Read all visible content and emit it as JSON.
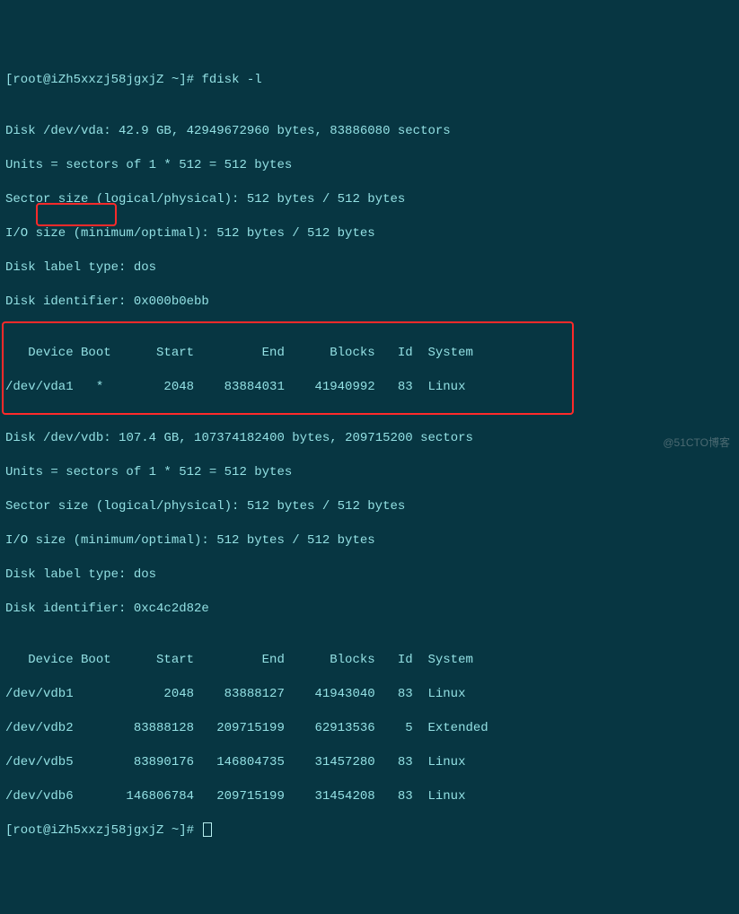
{
  "prompt1": {
    "open": "[",
    "user_host": "root@iZh5xxzj58jgxjZ",
    "cwd": " ~",
    "close": "]# ",
    "command": "fdisk -l"
  },
  "blank": "",
  "vda": {
    "header": "Disk /dev/vda: 42.9 GB, 42949672960 bytes, 83886080 sectors",
    "units": "Units = sectors of 1 * 512 = 512 bytes",
    "sector": "Sector size (logical/physical): 512 bytes / 512 bytes",
    "io": "I/O size (minimum/optimal): 512 bytes / 512 bytes",
    "label": "Disk label type: dos",
    "ident": "Disk identifier: 0x000b0ebb",
    "cols": "   Device Boot      Start         End      Blocks   Id  System",
    "row1": "/dev/vda1   *        2048    83884031    41940992   83  Linux"
  },
  "vdb": {
    "header_pre": "Disk ",
    "header_dev": "/dev/vdb:",
    "header_post": " 107.4 GB, 107374182400 bytes, 209715200 sectors",
    "units": "Units = sectors of 1 * 512 = 512 bytes",
    "sector": "Sector size (logical/physical): 512 bytes / 512 bytes",
    "io": "I/O size (minimum/optimal): 512 bytes / 512 bytes",
    "label": "Disk label type: dos",
    "ident": "Disk identifier: 0xc4c2d82e",
    "cols": "   Device Boot      Start         End      Blocks   Id  System",
    "row1": "/dev/vdb1            2048    83888127    41943040   83  Linux",
    "row2": "/dev/vdb2        83888128   209715199    62913536    5  Extended",
    "row3": "/dev/vdb5        83890176   146804735    31457280   83  Linux",
    "row4": "/dev/vdb6       146806784   209715199    31454208   83  Linux"
  },
  "prompt2": {
    "open": "[",
    "user_host": "root@iZh5xxzj58jgxjZ",
    "cwd": " ~",
    "close": "]# "
  },
  "watermark": "@51CTO博客",
  "chart_data": {
    "type": "table",
    "title": "fdisk -l partition listing",
    "disks": [
      {
        "device": "/dev/vda",
        "size_gb": 42.9,
        "bytes": 42949672960,
        "sectors": 83886080,
        "sector_size_bytes": 512,
        "io_size_bytes": 512,
        "label_type": "dos",
        "identifier": "0x000b0ebb",
        "partitions": [
          {
            "device": "/dev/vda1",
            "boot": true,
            "start": 2048,
            "end": 83884031,
            "blocks": 41940992,
            "id": "83",
            "system": "Linux"
          }
        ]
      },
      {
        "device": "/dev/vdb",
        "size_gb": 107.4,
        "bytes": 107374182400,
        "sectors": 209715200,
        "sector_size_bytes": 512,
        "io_size_bytes": 512,
        "label_type": "dos",
        "identifier": "0xc4c2d82e",
        "partitions": [
          {
            "device": "/dev/vdb1",
            "boot": false,
            "start": 2048,
            "end": 83888127,
            "blocks": 41943040,
            "id": "83",
            "system": "Linux"
          },
          {
            "device": "/dev/vdb2",
            "boot": false,
            "start": 83888128,
            "end": 209715199,
            "blocks": 62913536,
            "id": "5",
            "system": "Extended"
          },
          {
            "device": "/dev/vdb5",
            "boot": false,
            "start": 83890176,
            "end": 146804735,
            "blocks": 31457280,
            "id": "83",
            "system": "Linux"
          },
          {
            "device": "/dev/vdb6",
            "boot": false,
            "start": 146806784,
            "end": 209715199,
            "blocks": 31454208,
            "id": "83",
            "system": "Linux"
          }
        ]
      }
    ]
  }
}
